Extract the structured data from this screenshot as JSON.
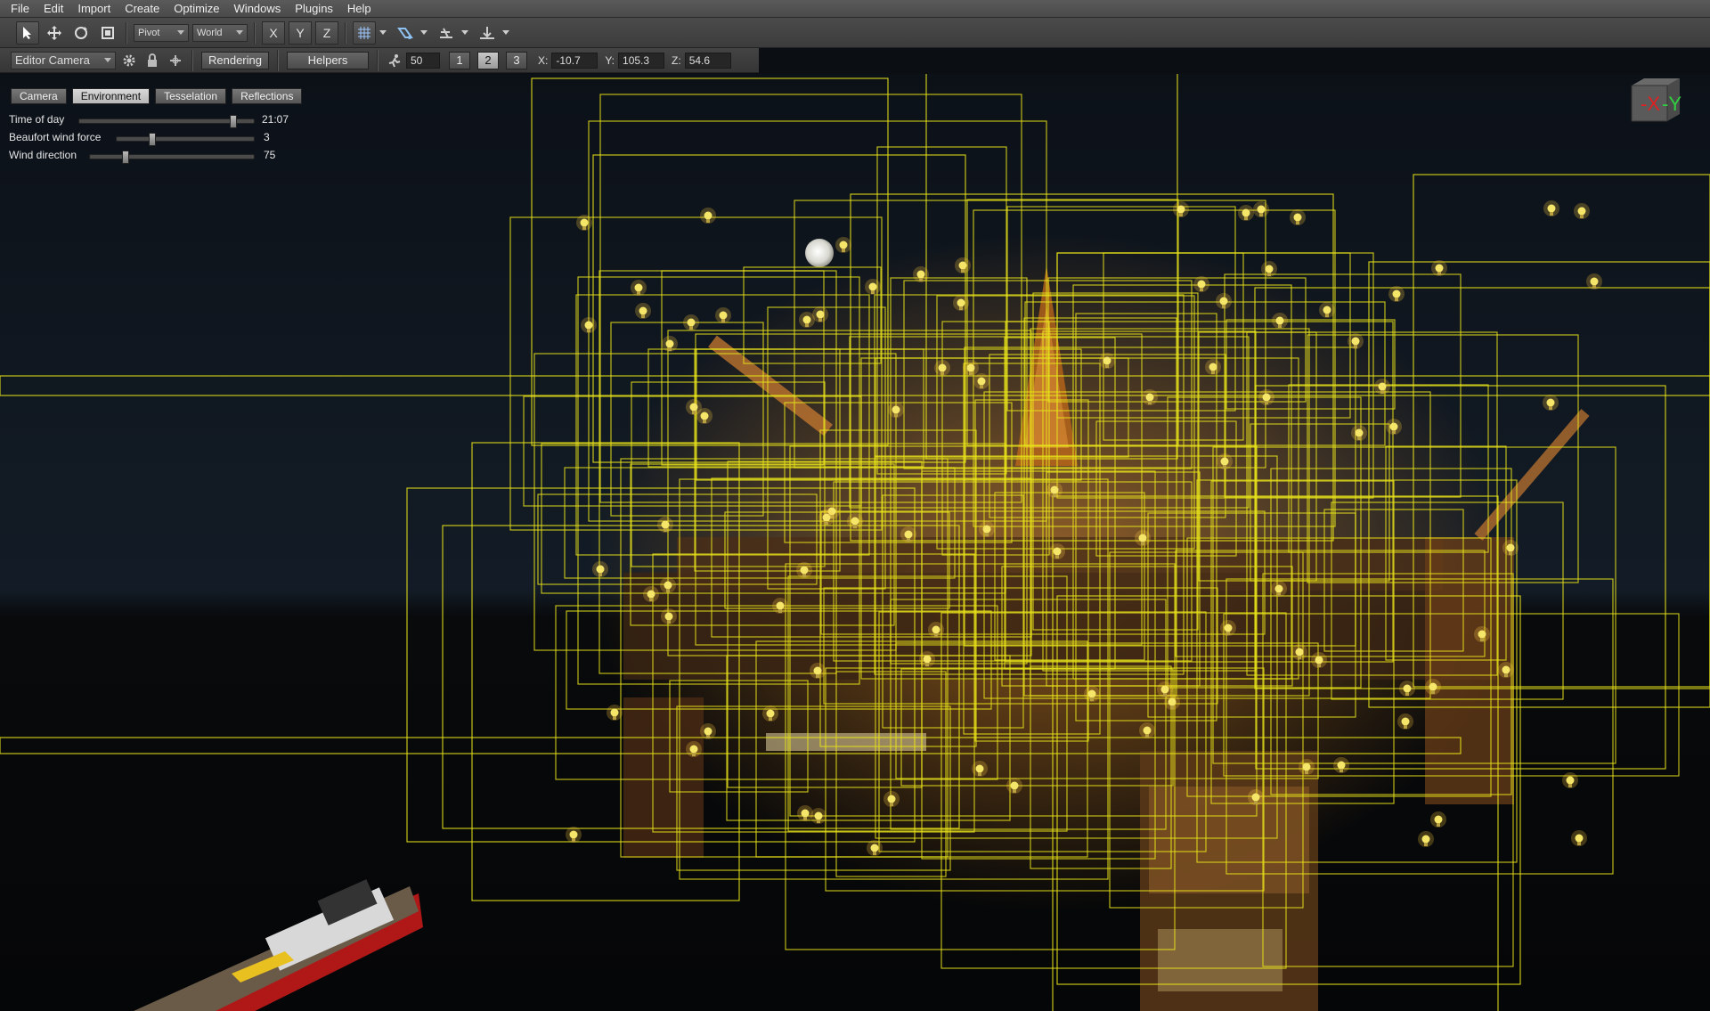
{
  "menu": [
    "File",
    "Edit",
    "Import",
    "Create",
    "Optimize",
    "Windows",
    "Plugins",
    "Help"
  ],
  "toolbar": {
    "pivot_label": "Pivot",
    "space_label": "World",
    "axis_x": "X",
    "axis_y": "Y",
    "axis_z": "Z"
  },
  "toolbar2": {
    "camera_label": "Editor Camera",
    "rendering_label": "Rendering",
    "helpers_label": "Helpers",
    "speed_value": "50",
    "speed_presets": [
      "1",
      "2",
      "3"
    ],
    "x_label": "X:",
    "x_value": "-10.7",
    "y_label": "Y:",
    "y_value": "105.3",
    "z_label": "Z:",
    "z_value": "54.6"
  },
  "environment_panel": {
    "tabs": [
      {
        "label": "Camera",
        "active": false
      },
      {
        "label": "Environment",
        "active": true
      },
      {
        "label": "Tesselation",
        "active": false
      },
      {
        "label": "Reflections",
        "active": false
      }
    ],
    "properties": [
      {
        "label": "Time of day",
        "value": "21:07",
        "fraction": 0.88
      },
      {
        "label": "Beaufort wind force",
        "value": "3",
        "fraction": 0.25
      },
      {
        "label": "Wind direction",
        "value": "75",
        "fraction": 0.21
      }
    ]
  },
  "view_cube": {
    "x_label": "-X",
    "y_label": "-Y",
    "x_color": "#e02020",
    "y_color": "#30d040"
  },
  "colors": {
    "bounding_box": "#e8e41a",
    "light_icon": "#f5e66a",
    "sky": "#0d1620",
    "sea": "#06080a"
  }
}
